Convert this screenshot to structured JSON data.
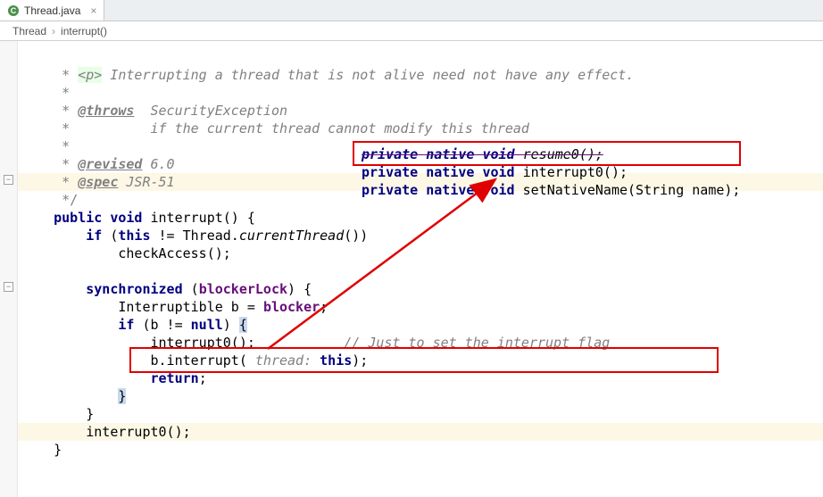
{
  "tab": {
    "filename": "Thread.java",
    "icon": "class-icon"
  },
  "breadcrumbs": {
    "class": "Thread",
    "method": "interrupt()"
  },
  "code": {
    "l0": "     * ",
    "l0p": "<p>",
    "l0b": " Interrupting a thread that is not alive need not have any effect.",
    "l1": "     *",
    "l2a": "     * ",
    "l2tag": "@throws",
    "l2b": "  SecurityException",
    "l3": "     *          if the current thread cannot modify this thread",
    "l4": "     *",
    "l5a": "     * ",
    "l5tag": "@revised",
    "l5b": " 6.0",
    "l6a": "     * ",
    "l6tag": "@spec",
    "l6b": " JSR-51",
    "l7": "     */",
    "l8a": "    ",
    "l8kw1": "public void ",
    "l8m": "interrupt() {",
    "l9a": "        ",
    "l9kw": "if ",
    "l9b": "(",
    "l9kw2": "this ",
    "l9c": "!= Thread.",
    "l9s": "currentThread",
    "l9d": "())",
    "l10": "            checkAccess();",
    "l11": "",
    "l12a": "        ",
    "l12kw": "synchronized ",
    "l12b": "(",
    "l12f": "blockerLock",
    "l12c": ") {",
    "l13a": "            Interruptible b = ",
    "l13f": "blocker",
    "l13b": ";",
    "l14a": "            ",
    "l14kw": "if ",
    "l14b": "(b != ",
    "l14kw2": "null",
    "l14c": ") ",
    "l14d": "{",
    "l15": "                interrupt0();",
    "l15c": "           // Just to set the interrupt flag",
    "l16a": "                b.interrupt(",
    "l16p": " thread: ",
    "l16kw": "this",
    "l16b": ");",
    "l17": "                ",
    "l17kw": "return",
    "l17b": ";",
    "l18": "            ",
    "l18b": "}",
    "l19": "        }",
    "l20": "        interrupt0();",
    "l21": "    }"
  },
  "overlay": {
    "o0a": "private native void ",
    "o0b": "resume0();",
    "o1a": "private native void ",
    "o1b": "interrupt0();",
    "o2a": "private native void ",
    "o2b": "setNativeName(String name);"
  }
}
